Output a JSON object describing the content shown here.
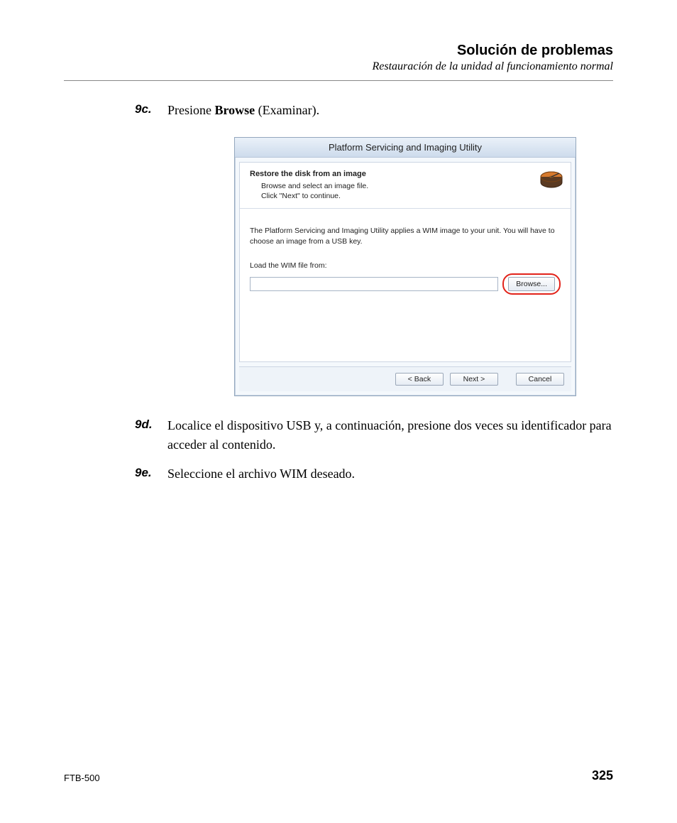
{
  "header": {
    "title": "Solución de problemas",
    "subtitle": "Restauración de la unidad al funcionamiento normal"
  },
  "steps": {
    "s9c": {
      "num": "9c.",
      "pre": "Presione ",
      "bold": "Browse",
      "post": " (Examinar)."
    },
    "s9d": {
      "num": "9d.",
      "text": "Localice el dispositivo USB y, a continuación, presione dos veces su identificador para acceder al contenido."
    },
    "s9e": {
      "num": "9e.",
      "text": "Seleccione el archivo WIM deseado."
    }
  },
  "wizard": {
    "title": "Platform Servicing and Imaging Utility",
    "head_title": "Restore the disk from an image",
    "head_line1": "Browse and select an image file.",
    "head_line2": "Click \"Next\" to continue.",
    "desc": "The Platform Servicing and Imaging Utility applies a WIM image to your unit. You will have to choose an image from a USB key.",
    "file_label": "Load the WIM file from:",
    "browse": "Browse...",
    "back": "< Back",
    "next": "Next >",
    "cancel": "Cancel"
  },
  "footer": {
    "left": "FTB-500",
    "right": "325"
  }
}
